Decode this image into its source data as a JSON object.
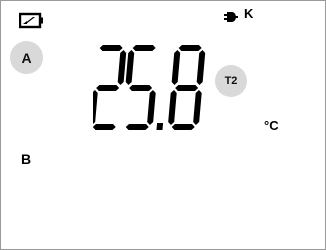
{
  "status": {
    "battery_icon": "battery-low-icon",
    "plug_icon": "plug-icon",
    "plug_label": "K"
  },
  "buttons": {
    "a_label": "A",
    "t2_label": "T2"
  },
  "reading": {
    "value": "25.8",
    "unit": "°C"
  },
  "side_label": "B",
  "colors": {
    "segment": "#000000",
    "button_bg": "#d9d9d9",
    "frame": "#9a9a9a"
  }
}
